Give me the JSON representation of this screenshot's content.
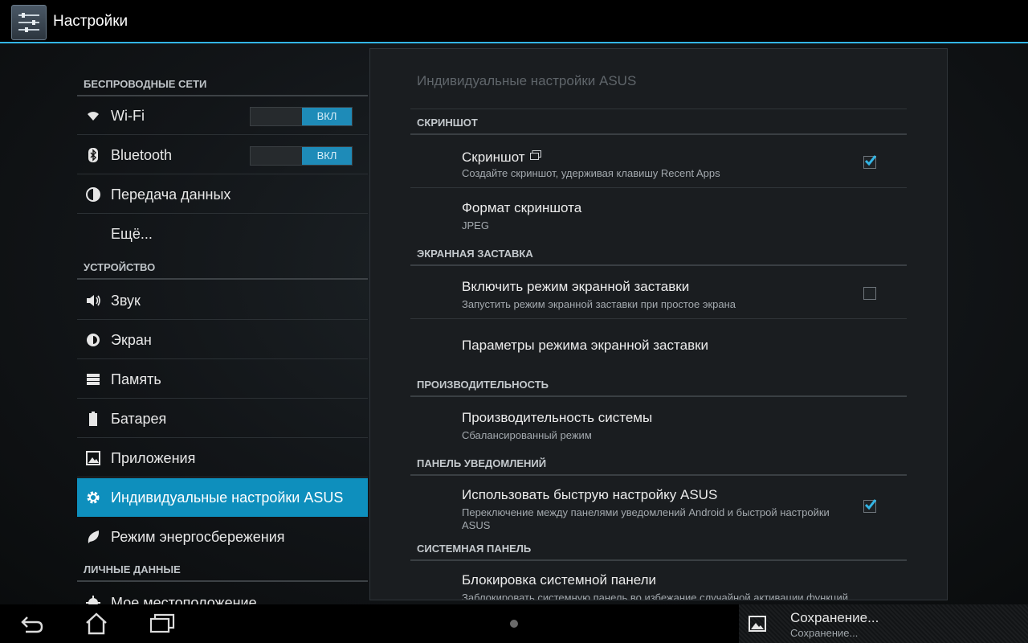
{
  "app": {
    "title": "Настройки",
    "icon": "settings-sliders-icon"
  },
  "left": {
    "sections": [
      {
        "header": "БЕСПРОВОДНЫЕ СЕТИ"
      },
      {
        "header": "УСТРОЙСТВО"
      },
      {
        "header": "ЛИЧНЫЕ ДАННЫЕ"
      }
    ],
    "items": [
      {
        "label": "Wi-Fi",
        "icon": "wifi-icon",
        "toggle": "ВКЛ"
      },
      {
        "label": "Bluetooth",
        "icon": "bluetooth-icon",
        "toggle": "ВКЛ"
      },
      {
        "label": "Передача данных",
        "icon": "data-usage-icon"
      },
      {
        "label": "Ещё..."
      },
      {
        "label": "Звук",
        "icon": "speaker-icon"
      },
      {
        "label": "Экран",
        "icon": "brightness-icon"
      },
      {
        "label": "Память",
        "icon": "storage-icon"
      },
      {
        "label": "Батарея",
        "icon": "battery-icon"
      },
      {
        "label": "Приложения",
        "icon": "apps-icon"
      },
      {
        "label": "Индивидуальные настройки ASUS",
        "icon": "gear-icon",
        "selected": true
      },
      {
        "label": "Режим энергосбережения",
        "icon": "leaf-icon"
      },
      {
        "label": "Мое местоположение",
        "icon": "location-icon"
      }
    ]
  },
  "panel": {
    "title": "Индивидуальные настройки ASUS",
    "categories": [
      "СКРИНШОТ",
      "ЭКРАННАЯ ЗАСТАВКА",
      "ПРОИЗВОДИТЕЛЬНОСТЬ",
      "ПАНЕЛЬ УВЕДОМЛЕНИЙ",
      "СИСТЕМНАЯ ПАНЕЛЬ"
    ],
    "prefs": [
      {
        "title": "Скриншот",
        "summary": "Создайте скриншот, удерживая клавишу Recent Apps",
        "checked": true
      },
      {
        "title": "Формат скриншота",
        "summary": "JPEG"
      },
      {
        "title": "Включить режим экранной заставки",
        "summary": "Запустить режим экранной заставки при простое экрана",
        "checked": false
      },
      {
        "title": "Параметры режима экранной заставки"
      },
      {
        "title": "Производительность системы",
        "summary": "Сбалансированный режим"
      },
      {
        "title": "Использовать быструю настройку ASUS",
        "summary": "Переключение между панелями уведомлений Android и быстрой настройки ASUS",
        "checked": true
      },
      {
        "title": "Блокировка системной панели",
        "summary": "Заблокировать системную панель во избежание случайной активации функций"
      }
    ]
  },
  "navbar": {
    "notification_title": "Сохранение...",
    "notification_sub": "Сохранение..."
  },
  "colors": {
    "accent": "#33b5e5",
    "selected": "#0e8fbd",
    "toggle_on": "#1e8bb8"
  }
}
